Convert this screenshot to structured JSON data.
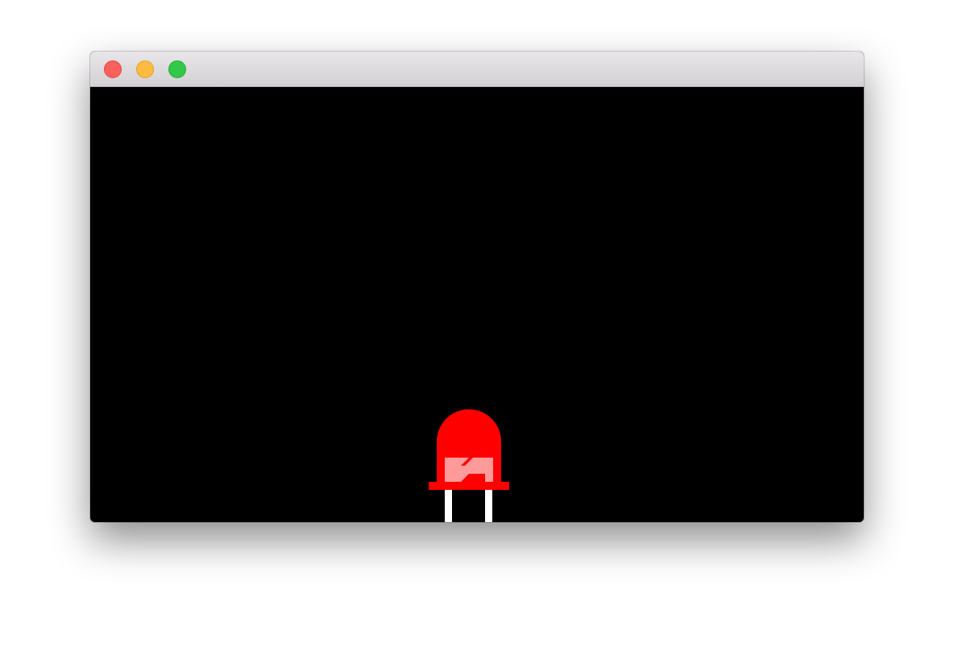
{
  "window": {
    "controls": {
      "close": {
        "icon": "close-circle-icon",
        "color": "#fc605c"
      },
      "minimize": {
        "icon": "minimize-circle-icon",
        "color": "#fdbc40"
      },
      "maximize": {
        "icon": "maximize-circle-icon",
        "color": "#34c84a"
      }
    }
  },
  "canvas": {
    "background": "#000000",
    "led": {
      "icon": "led-icon",
      "state": "on",
      "body_color": "#ff0000",
      "highlight_color": "#ff9a9a",
      "leg_color": "#ffffff"
    }
  }
}
